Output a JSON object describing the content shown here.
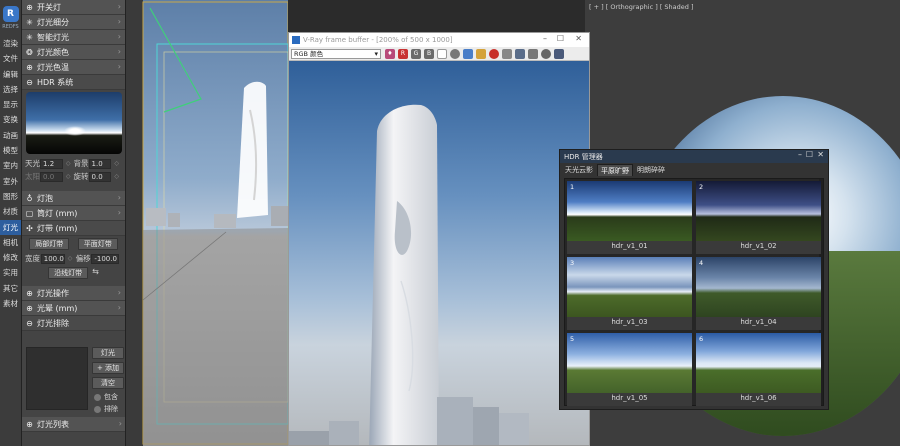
{
  "sidebar": {
    "logo_label": "REDFS",
    "tabs": [
      "渲染",
      "文件",
      "编辑",
      "选择",
      "显示",
      "变换",
      "动画",
      "模型",
      "室内",
      "室外",
      "图形",
      "材质",
      "灯光",
      "相机",
      "修改",
      "实用",
      "其它",
      "素材"
    ],
    "active_tab": "灯光"
  },
  "panel": {
    "rollouts_top": [
      "开关灯",
      "灯光细分",
      "智能灯光",
      "灯光颜色",
      "灯光色温"
    ],
    "hdr_title": "HDR 系统",
    "params": [
      {
        "k1": "天光",
        "v1": "1.2",
        "k2": "背景",
        "v2": "1.0"
      },
      {
        "k1": "太阳",
        "v1": "0.0",
        "k2": "旋转",
        "v2": "0.0"
      }
    ],
    "rollouts_mid": [
      "灯泡",
      "筒灯 (mm)"
    ],
    "strip_title": "灯带 (mm)",
    "strip_btn_left": "局部灯带",
    "strip_btn_right": "平面灯带",
    "strip_params": {
      "k1": "宽度",
      "v1": "100.0",
      "k2": "偏移",
      "v2": "-100.0"
    },
    "strip_btn_center": "沿线灯带",
    "rollouts_bottom": [
      "灯光操作",
      "光晕 (mm)"
    ],
    "exclude_title": "灯光排除",
    "exclude_btns": [
      "灯光",
      "+ 添加",
      "清空"
    ],
    "exclude_radios": [
      "包含",
      "排除"
    ],
    "last_rollout": "灯光列表"
  },
  "viewport_right": {
    "label": "[ + ] [ Orthographic ] [ Shaded ]"
  },
  "vfb": {
    "title": "V-Ray frame buffer - [200% of 500 x 1000]",
    "channel": "RGB 颜色",
    "min_icon": "–",
    "max_icon": "☐",
    "close_icon": "✕"
  },
  "hdr_manager": {
    "title": "HDR 管理器",
    "tabs": [
      "天光云影",
      "平原旷野",
      "明朗碎碎"
    ],
    "active_tab": "平原旷野",
    "items": [
      {
        "num": "1",
        "name": "hdr_v1_01"
      },
      {
        "num": "2",
        "name": "hdr_v1_02"
      },
      {
        "num": "3",
        "name": "hdr_v1_03"
      },
      {
        "num": "4",
        "name": "hdr_v1_04"
      },
      {
        "num": "5",
        "name": "hdr_v1_05"
      },
      {
        "num": "6",
        "name": "hdr_v1_06"
      }
    ]
  },
  "colors": {
    "accent": "#2d5e9e",
    "panel": "#444444",
    "rollout": "#535353"
  }
}
